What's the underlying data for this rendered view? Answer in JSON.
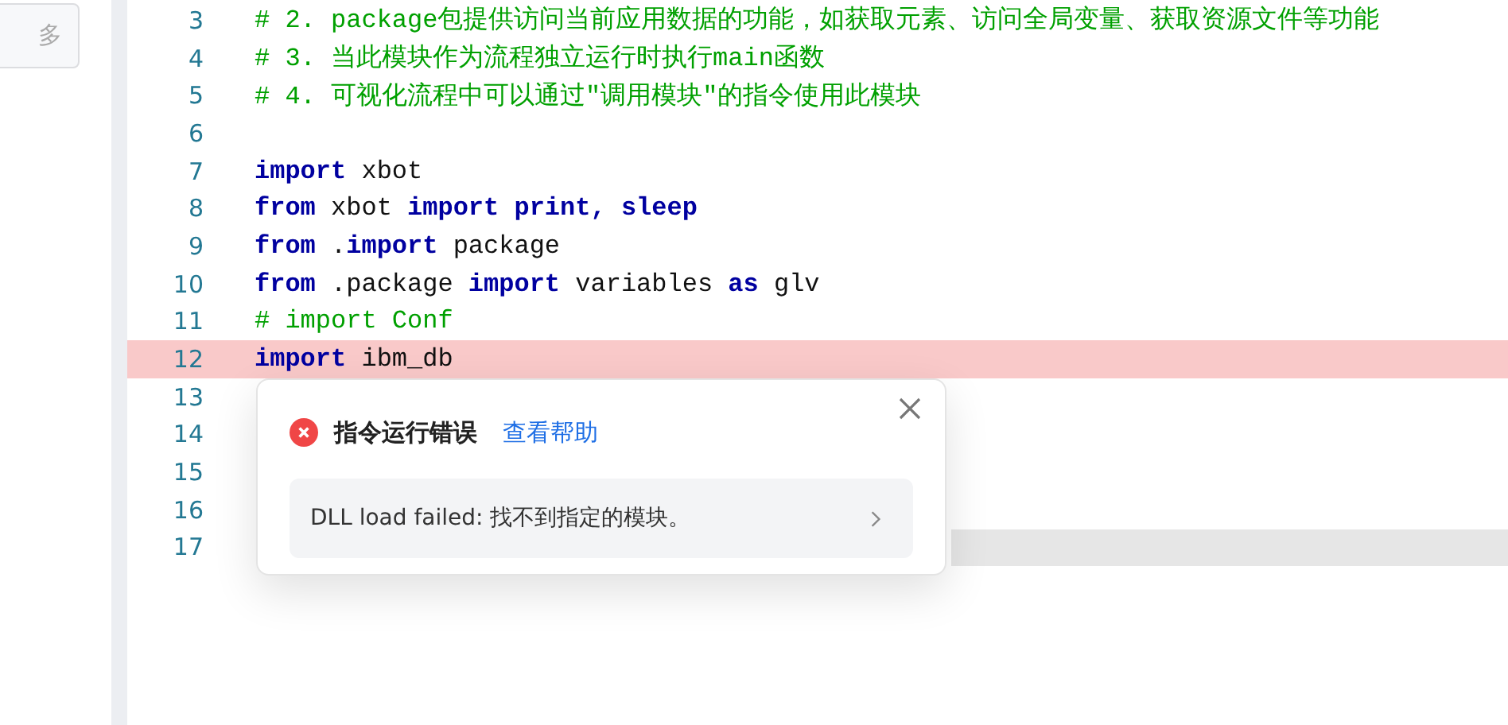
{
  "sidebar": {
    "more_button": "多"
  },
  "editor": {
    "lines": [
      {
        "number": "3",
        "error": false,
        "current": false,
        "tokens": [
          {
            "kind": "comment",
            "text": "# 2. package包提供访问当前应用数据的功能，如获取元素、访问全局变量、获取资源文件等功能"
          }
        ]
      },
      {
        "number": "4",
        "error": false,
        "current": false,
        "tokens": [
          {
            "kind": "comment",
            "text": "# 3. 当此模块作为流程独立运行时执行main函数"
          }
        ]
      },
      {
        "number": "5",
        "error": false,
        "current": false,
        "tokens": [
          {
            "kind": "comment",
            "text": "# 4. 可视化流程中可以通过\"调用模块\"的指令使用此模块"
          }
        ]
      },
      {
        "number": "6",
        "error": false,
        "current": false
      },
      {
        "number": "7",
        "error": false,
        "current": false,
        "tokens": [
          {
            "kind": "keyword",
            "text": "import"
          },
          {
            "kind": "plain",
            "text": " xbot"
          }
        ]
      },
      {
        "number": "8",
        "error": false,
        "current": false,
        "tokens": [
          {
            "kind": "keyword",
            "text": "from"
          },
          {
            "kind": "plain",
            "text": " xbot "
          },
          {
            "kind": "keyword",
            "text": "import print, sleep"
          }
        ]
      },
      {
        "number": "9",
        "error": false,
        "current": false,
        "tokens": [
          {
            "kind": "keyword",
            "text": "from"
          },
          {
            "kind": "plain",
            "text": " ."
          },
          {
            "kind": "keyword",
            "text": "import"
          },
          {
            "kind": "plain",
            "text": " package"
          }
        ]
      },
      {
        "number": "10",
        "error": false,
        "current": false,
        "tokens": [
          {
            "kind": "keyword",
            "text": "from"
          },
          {
            "kind": "plain",
            "text": " .package "
          },
          {
            "kind": "keyword",
            "text": "import"
          },
          {
            "kind": "plain",
            "text": " variables "
          },
          {
            "kind": "keyword",
            "text": "as"
          },
          {
            "kind": "plain",
            "text": " glv"
          }
        ]
      },
      {
        "number": "11",
        "error": false,
        "current": false,
        "tokens": [
          {
            "kind": "comment",
            "text": "# import Conf"
          }
        ]
      },
      {
        "number": "12",
        "error": true,
        "current": false,
        "tokens": [
          {
            "kind": "keyword",
            "text": "import"
          },
          {
            "kind": "plain",
            "text": " ibm_db"
          }
        ]
      },
      {
        "number": "13",
        "error": false,
        "current": false
      },
      {
        "number": "14",
        "error": false,
        "current": false
      },
      {
        "number": "15",
        "error": false,
        "current": false
      },
      {
        "number": "16",
        "error": false,
        "current": false
      },
      {
        "number": "17",
        "error": false,
        "current": true
      }
    ]
  },
  "error_popup": {
    "title": "指令运行错误",
    "help_link": "查看帮助",
    "message": "DLL load failed: 找不到指定的模块。"
  }
}
